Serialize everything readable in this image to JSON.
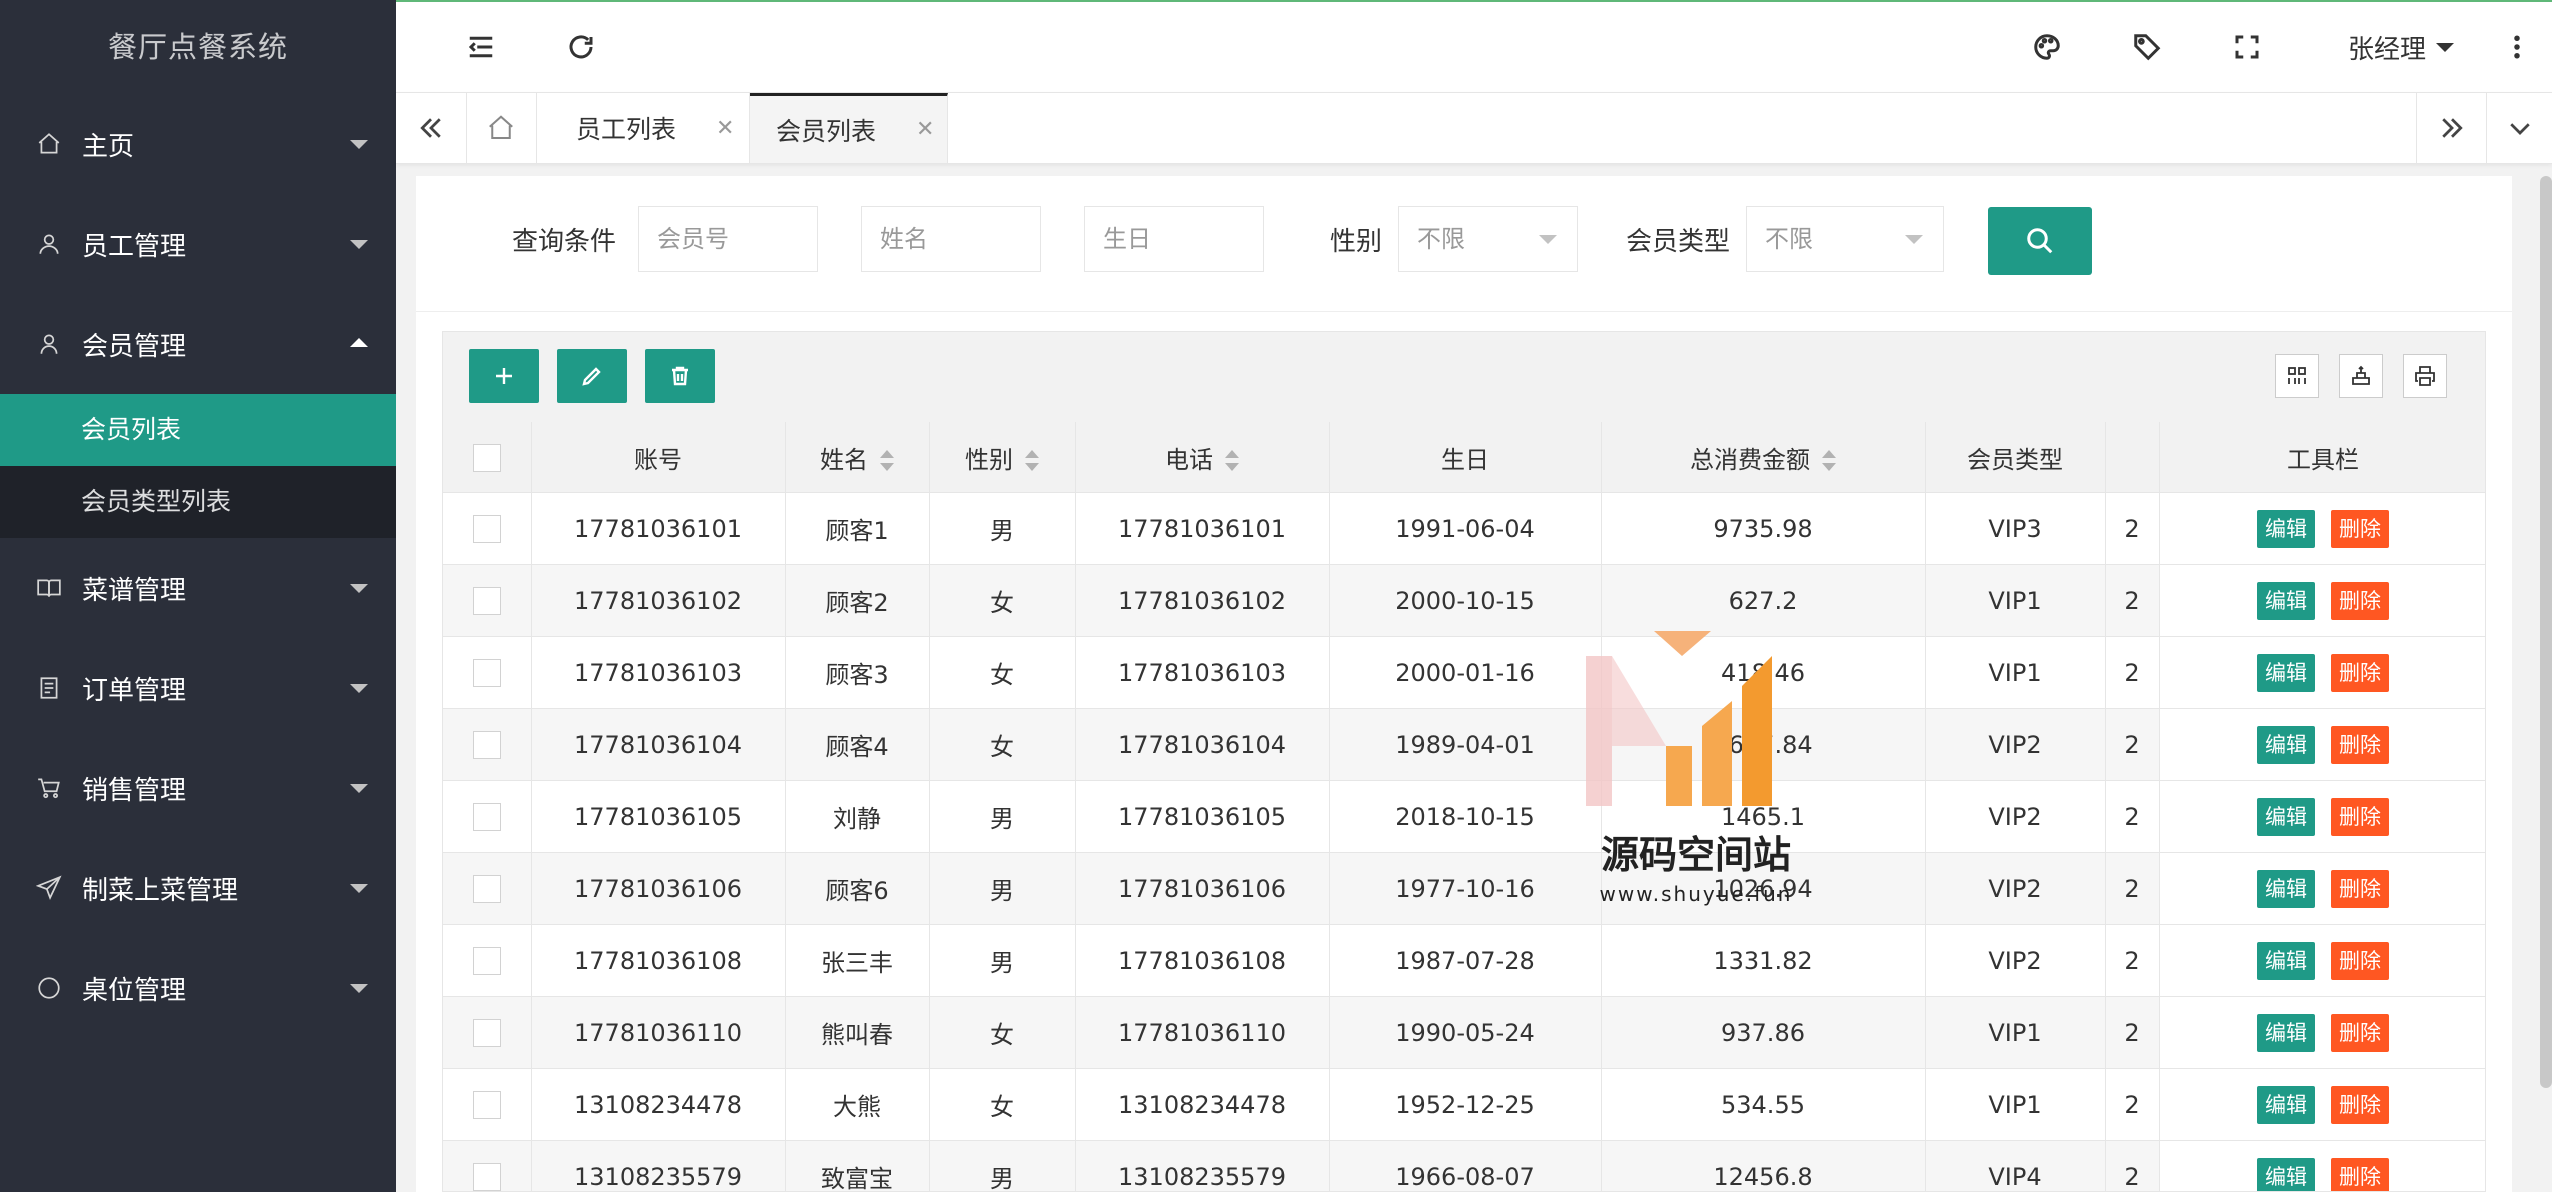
{
  "app": {
    "title": "餐厅点餐系统"
  },
  "sidebar": {
    "items": [
      {
        "label": "主页",
        "icon": "home-icon",
        "expanded": false
      },
      {
        "label": "员工管理",
        "icon": "staff-icon",
        "expanded": false
      },
      {
        "label": "会员管理",
        "icon": "member-icon",
        "expanded": true,
        "children": [
          {
            "label": "会员列表",
            "active": true
          },
          {
            "label": "会员类型列表",
            "active": false
          }
        ]
      },
      {
        "label": "菜谱管理",
        "icon": "menu-book-icon",
        "expanded": false
      },
      {
        "label": "订单管理",
        "icon": "order-icon",
        "expanded": false
      },
      {
        "label": "销售管理",
        "icon": "cart-icon",
        "expanded": false
      },
      {
        "label": "制菜上菜管理",
        "icon": "send-icon",
        "expanded": false
      },
      {
        "label": "桌位管理",
        "icon": "circle-icon",
        "expanded": false
      }
    ]
  },
  "header": {
    "icons": [
      "collapse-menu-icon",
      "refresh-icon",
      "theme-palette-icon",
      "tag-icon",
      "fullscreen-icon",
      "more-icon"
    ],
    "user": "张经理"
  },
  "tabs": [
    {
      "label": "员工列表",
      "active": false
    },
    {
      "label": "会员列表",
      "active": true
    }
  ],
  "search": {
    "title": "查询条件",
    "member_no_placeholder": "会员号",
    "name_placeholder": "姓名",
    "birthday_placeholder": "生日",
    "gender_label": "性别",
    "gender_value": "不限",
    "type_label": "会员类型",
    "type_value": "不限"
  },
  "table": {
    "columns": [
      "账号",
      "姓名",
      "性别",
      "电话",
      "生日",
      "总消费金额",
      "会员类型",
      "工具栏"
    ],
    "edit_label": "编辑",
    "delete_label": "删除",
    "rows": [
      {
        "account": "17781036101",
        "name": "顾客1",
        "gender": "男",
        "phone": "17781036101",
        "birthday": "1991-06-04",
        "total": "9735.98",
        "type": "VIP3",
        "extra": "2"
      },
      {
        "account": "17781036102",
        "name": "顾客2",
        "gender": "女",
        "phone": "17781036102",
        "birthday": "2000-10-15",
        "total": "627.2",
        "type": "VIP1",
        "extra": "2"
      },
      {
        "account": "17781036103",
        "name": "顾客3",
        "gender": "女",
        "phone": "17781036103",
        "birthday": "2000-01-16",
        "total": "418.46",
        "type": "VIP1",
        "extra": "2"
      },
      {
        "account": "17781036104",
        "name": "顾客4",
        "gender": "女",
        "phone": "17781036104",
        "birthday": "1989-04-01",
        "total": "1607.84",
        "type": "VIP2",
        "extra": "2"
      },
      {
        "account": "17781036105",
        "name": "刘静",
        "gender": "男",
        "phone": "17781036105",
        "birthday": "2018-10-15",
        "total": "1465.1",
        "type": "VIP2",
        "extra": "2"
      },
      {
        "account": "17781036106",
        "name": "顾客6",
        "gender": "男",
        "phone": "17781036106",
        "birthday": "1977-10-16",
        "total": "1026.94",
        "type": "VIP2",
        "extra": "2"
      },
      {
        "account": "17781036108",
        "name": "张三丰",
        "gender": "男",
        "phone": "17781036108",
        "birthday": "1987-07-28",
        "total": "1331.82",
        "type": "VIP2",
        "extra": "2"
      },
      {
        "account": "17781036110",
        "name": "熊叫春",
        "gender": "女",
        "phone": "17781036110",
        "birthday": "1990-05-24",
        "total": "937.86",
        "type": "VIP1",
        "extra": "2"
      },
      {
        "account": "13108234478",
        "name": "大熊",
        "gender": "女",
        "phone": "13108234478",
        "birthday": "1952-12-25",
        "total": "534.55",
        "type": "VIP1",
        "extra": "2"
      },
      {
        "account": "13108235579",
        "name": "致富宝",
        "gender": "男",
        "phone": "13108235579",
        "birthday": "1966-08-07",
        "total": "12456.8",
        "type": "VIP4",
        "extra": "2"
      }
    ]
  },
  "watermark": {
    "text": "源码空间站",
    "url": "www.shuyue.fun"
  },
  "colors": {
    "sidebar": "#2b2f3a",
    "accent": "#1f9a87",
    "danger": "#ff5722"
  }
}
